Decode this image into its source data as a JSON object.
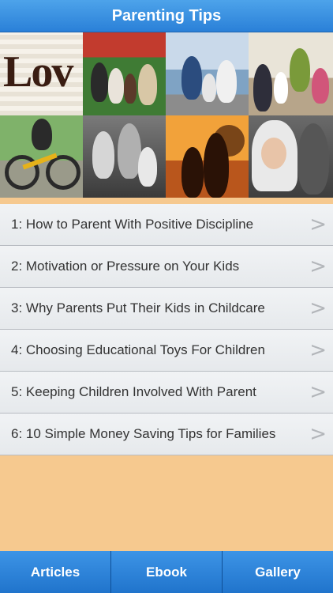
{
  "header": {
    "title": "Parenting Tips"
  },
  "banner": {
    "photos": [
      "love-word-collage",
      "family-in-garden",
      "family-on-bench-by-water",
      "family-at-dinner-table",
      "child-riding-bicycle",
      "family-portrait-black-and-white",
      "mother-and-child-silhouette-sunset",
      "child-in-winter-hood"
    ],
    "love_text": "Lov"
  },
  "articles": [
    {
      "label": "1: How to Parent With Positive Discipline",
      "chevron": ">"
    },
    {
      "label": "2: Motivation or Pressure on Your Kids",
      "chevron": ">"
    },
    {
      "label": "3: Why Parents Put Their Kids in Childcare",
      "chevron": ">"
    },
    {
      "label": "4: Choosing Educational Toys For Children",
      "chevron": ">"
    },
    {
      "label": "5: Keeping Children Involved With Parent",
      "chevron": ">"
    },
    {
      "label": "6: 10 Simple Money Saving Tips for Families",
      "chevron": ">"
    }
  ],
  "tabs": [
    {
      "label": "Articles"
    },
    {
      "label": "Ebook"
    },
    {
      "label": "Gallery"
    }
  ],
  "colors": {
    "nav_blue": "#2a80d8",
    "background_peach": "#f6c98f",
    "row_gray": "#eceff2"
  }
}
